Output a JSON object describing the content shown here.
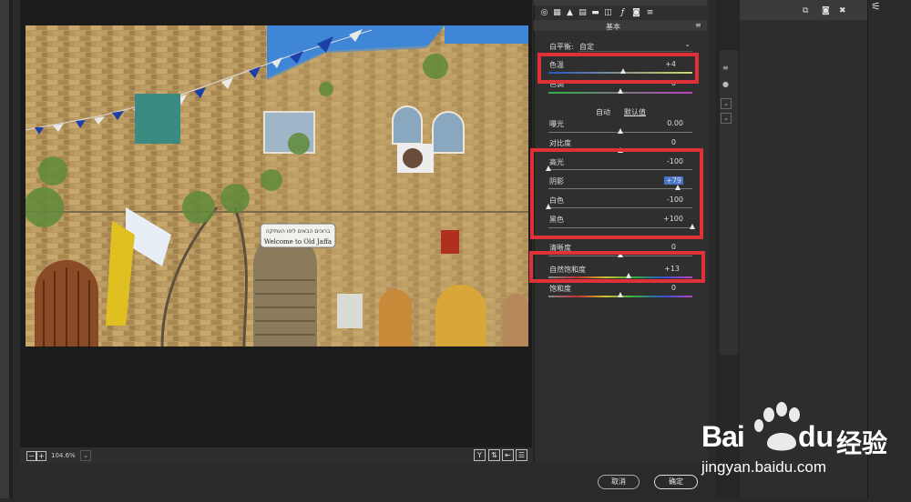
{
  "panel": {
    "tab_label": "基本",
    "white_balance": {
      "label": "白平衡:",
      "value": "自定"
    },
    "auto_label": "自动",
    "default_label": "默认值",
    "sliders": [
      {
        "key": "temp",
        "label": "色温",
        "value": "+4",
        "level": 0.52
      },
      {
        "key": "tint",
        "label": "色调",
        "value": "0",
        "level": 0.5
      },
      {
        "key": "exposure",
        "label": "曝光",
        "value": "0.00",
        "level": 0.5
      },
      {
        "key": "contrast",
        "label": "对比度",
        "value": "0",
        "level": 0.5
      },
      {
        "key": "highlights",
        "label": "高光",
        "value": "-100",
        "level": 0.0
      },
      {
        "key": "shadows",
        "label": "阴影",
        "value": "+79",
        "level": 0.9
      },
      {
        "key": "whites",
        "label": "白色",
        "value": "-100",
        "level": 0.0
      },
      {
        "key": "blacks",
        "label": "黑色",
        "value": "+100",
        "level": 1.0
      },
      {
        "key": "clarity",
        "label": "清晰度",
        "value": "0",
        "level": 0.5
      },
      {
        "key": "vibrance",
        "label": "自然饱和度",
        "value": "+13",
        "level": 0.56
      },
      {
        "key": "saturation",
        "label": "饱和度",
        "value": "0",
        "level": 0.5
      }
    ]
  },
  "bottom_bar": {
    "zoom": "104.6%",
    "minus": "−",
    "plus": "+",
    "view_y": "Y"
  },
  "buttons": {
    "cancel": "取消",
    "ok": "确定"
  },
  "photo_sign": {
    "hebrew": "ברוכים הבאים ליפו העתיקה",
    "english": "Welcome to Old Jaffa"
  },
  "watermark": {
    "brand": "Bai",
    "brand2": "du",
    "cn": "经验",
    "url": "jingyan.baidu.com"
  },
  "colors": {
    "highlight_box": "#e03038",
    "panel_bg": "#2f2f2f"
  }
}
